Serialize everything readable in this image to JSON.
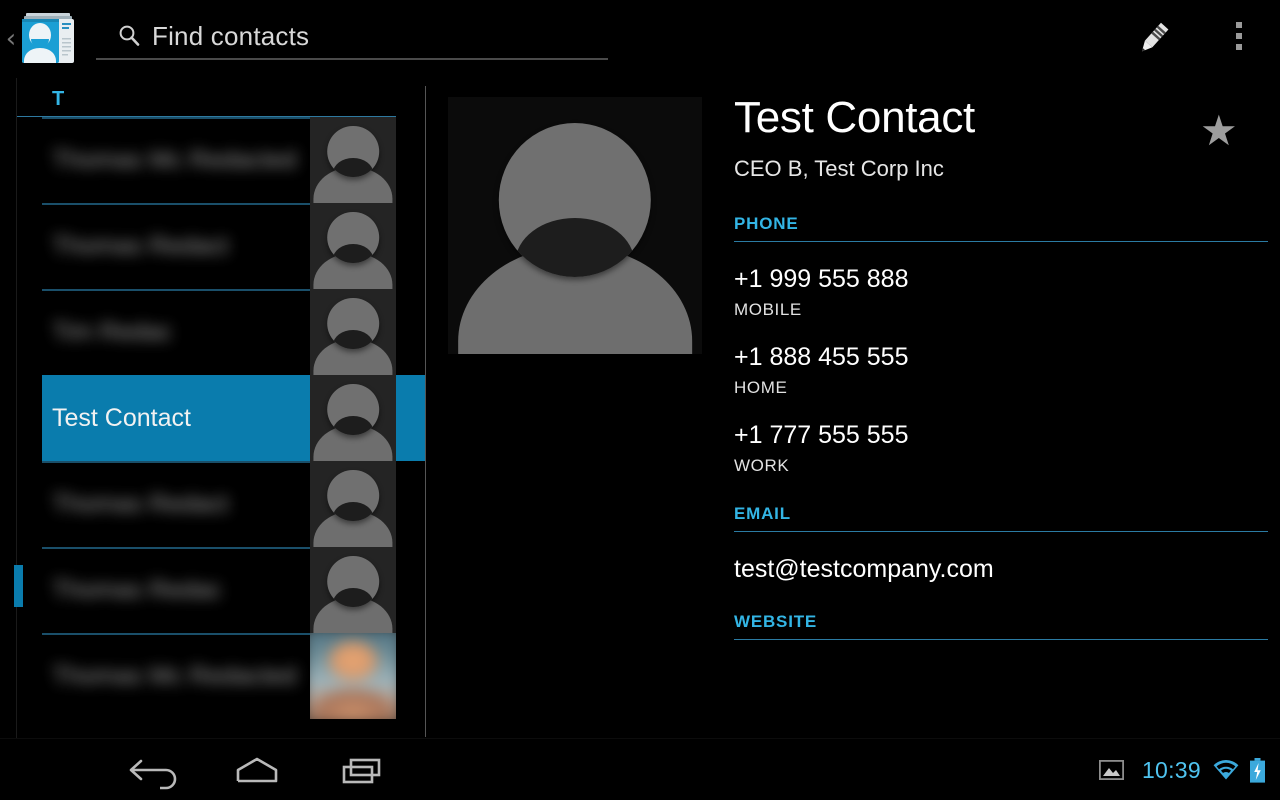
{
  "action_bar": {
    "app_icon": "contacts-app-icon",
    "back_chevron": "‹",
    "search": {
      "placeholder": "Find contacts",
      "value": "",
      "icon": "search-icon"
    },
    "edit_icon": "pencil-edit-icon",
    "overflow_icon": "overflow-menu-icon"
  },
  "list_pane": {
    "section_header": "T",
    "rows": [
      {
        "name": "Thomas Mc Redacted",
        "redacted": true,
        "avatar": "placeholder",
        "selected": false
      },
      {
        "name": "Thomas Redact",
        "redacted": true,
        "avatar": "placeholder",
        "selected": false
      },
      {
        "name": "Tim Redac",
        "redacted": true,
        "avatar": "placeholder",
        "selected": false
      },
      {
        "name": "Test Contact",
        "redacted": false,
        "avatar": "placeholder",
        "selected": true
      },
      {
        "name": "Thomas Redact",
        "redacted": true,
        "avatar": "placeholder",
        "selected": false
      },
      {
        "name": "Thomas Redac",
        "redacted": true,
        "avatar": "placeholder",
        "selected": false
      },
      {
        "name": "Thomas Mc Redacted",
        "redacted": true,
        "avatar": "photo",
        "selected": false
      }
    ]
  },
  "detail": {
    "photo": "contact-photo-placeholder",
    "name": "Test Contact",
    "organization": "CEO B, Test Corp Inc",
    "favorite_icon": "★",
    "sections": [
      {
        "label": "PHONE",
        "items": [
          {
            "value": "+1 999 555 888",
            "type": "MOBILE"
          },
          {
            "value": "+1 888 455 555",
            "type": "HOME"
          },
          {
            "value": "+1 777 555 555",
            "type": "WORK"
          }
        ]
      },
      {
        "label": "EMAIL",
        "items": [
          {
            "value": "test@testcompany.com",
            "type": ""
          }
        ]
      },
      {
        "label": "WEBSITE",
        "items": []
      }
    ]
  },
  "system_bar": {
    "back_icon": "back-nav-icon",
    "home_icon": "home-nav-icon",
    "recents_icon": "recents-nav-icon",
    "screenshot_icon": "image-icon",
    "clock": "10:39",
    "wifi_icon": "wifi-icon",
    "battery_icon": "battery-charging-icon"
  },
  "colors": {
    "accent_blue": "#33b5e5",
    "selection_blue": "#0a7cad",
    "clock_blue": "#4fc3ef",
    "background": "#000000"
  }
}
